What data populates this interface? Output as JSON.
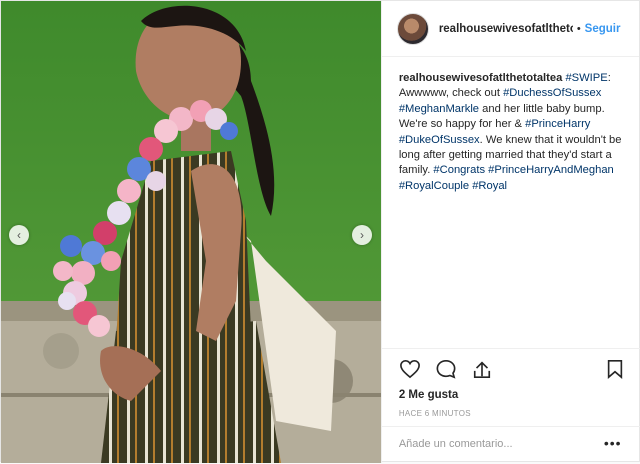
{
  "post": {
    "username": "realhousewivesofatlthetotaltea",
    "dot": "•",
    "follow_label": "Seguir",
    "caption": {
      "username": "realhousewivesofatlthetotaltea",
      "parts": [
        {
          "text": "#SWIPE",
          "tag": true
        },
        {
          "text": ": Awwwww, check out ",
          "tag": false
        },
        {
          "text": "#DuchessOfSussex",
          "tag": true
        },
        {
          "text": " ",
          "tag": false
        },
        {
          "text": "#MeghanMarkle",
          "tag": true
        },
        {
          "text": " and her little baby bump. We're so happy for her & ",
          "tag": false
        },
        {
          "text": "#PrinceHarry",
          "tag": true
        },
        {
          "text": " ",
          "tag": false
        },
        {
          "text": "#DukeOfSussex",
          "tag": true
        },
        {
          "text": ". We knew that it wouldn't be long after getting married that they'd start a family. ",
          "tag": false
        },
        {
          "text": "#Congrats",
          "tag": true
        },
        {
          "text": " ",
          "tag": false
        },
        {
          "text": "#PrinceHarryAndMeghan",
          "tag": true
        },
        {
          "text": " ",
          "tag": false
        },
        {
          "text": "#RoyalCouple",
          "tag": true
        },
        {
          "text": " ",
          "tag": false
        },
        {
          "text": "#Royal",
          "tag": true
        }
      ]
    },
    "likes": "2 Me gusta",
    "time": "HACE 6 MINUTOS",
    "comment_placeholder": "Añade un comentario...",
    "more": "•••",
    "nav_prev": "‹",
    "nav_next": "›"
  },
  "icons": {
    "like": "heart-icon",
    "comment": "comment-icon",
    "share": "share-icon",
    "save": "bookmark-icon"
  },
  "colors": {
    "link": "#003569",
    "follow": "#3897f0",
    "muted": "#999999"
  }
}
